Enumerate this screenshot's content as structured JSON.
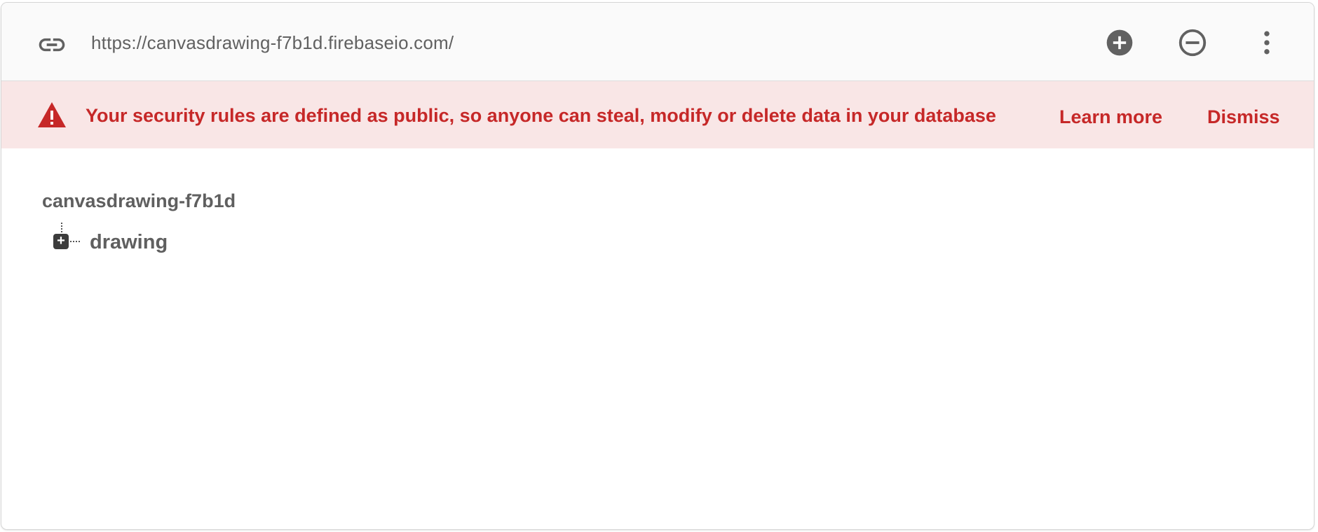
{
  "url_bar": {
    "url": "https://canvasdrawing-f7b1d.firebaseio.com/",
    "link_icon": "link-icon",
    "actions": [
      {
        "icon": "add-circle-icon"
      },
      {
        "icon": "remove-circle-icon"
      },
      {
        "icon": "more-vert-icon"
      }
    ]
  },
  "banner": {
    "icon": "warning-icon",
    "message": "Your security rules are defined as public, so anyone can steal, modify or delete data in your database",
    "learn_more": "Learn more",
    "dismiss": "Dismiss",
    "background_color": "#f9e6e6",
    "text_color": "#c62828"
  },
  "tree": {
    "root": "canvasdrawing-f7b1d",
    "children": [
      {
        "name": "drawing",
        "expand_symbol": "+"
      }
    ]
  }
}
